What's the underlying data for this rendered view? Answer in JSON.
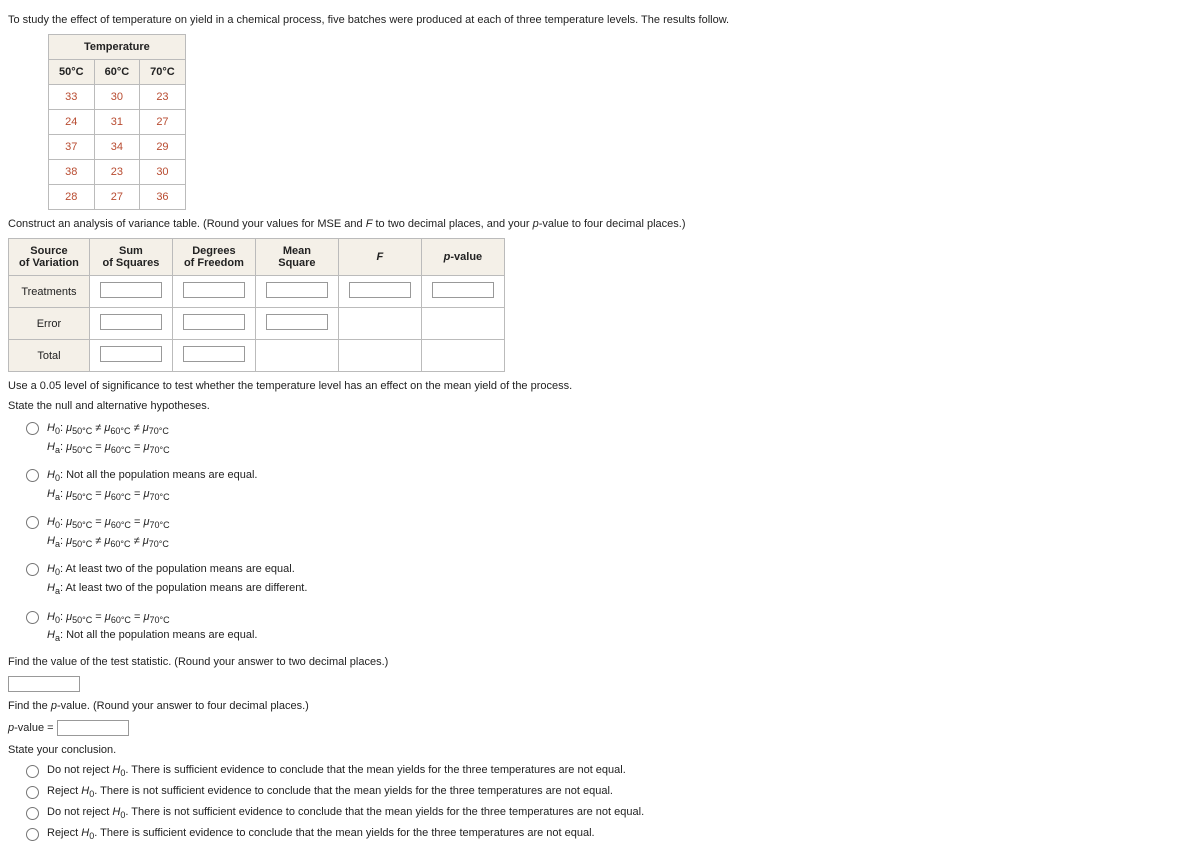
{
  "intro": "To study the effect of temperature on yield in a chemical process, five batches were produced at each of three temperature levels. The results follow.",
  "temp_table": {
    "header_span": "Temperature",
    "cols": [
      "50°C",
      "60°C",
      "70°C"
    ],
    "rows": [
      [
        "33",
        "30",
        "23"
      ],
      [
        "24",
        "31",
        "27"
      ],
      [
        "37",
        "34",
        "29"
      ],
      [
        "38",
        "23",
        "30"
      ],
      [
        "28",
        "27",
        "36"
      ]
    ]
  },
  "anova_instruction": "Construct an analysis of variance table. (Round your values for MSE and F to two decimal places, and your p-value to four decimal places.)",
  "anova_headers": {
    "source": "Source\nof Variation",
    "ss": "Sum\nof Squares",
    "df": "Degrees\nof Freedom",
    "ms": "Mean\nSquare",
    "f": "F",
    "p": "p-value"
  },
  "anova_rows": [
    "Treatments",
    "Error",
    "Total"
  ],
  "sig_instruction": "Use a 0.05 level of significance to test whether the temperature level has an effect on the mean yield of the process.",
  "state_hyp": "State the null and alternative hypotheses.",
  "mu50": "μ",
  "s50": "50°C",
  "mu60": "μ",
  "s60": "60°C",
  "mu70": "μ",
  "s70": "70°C",
  "hyps": {
    "opt1_h0": "H₀: μ50°C ≠ μ60°C ≠ μ70°C",
    "opt1_ha": "Hₐ: μ50°C = μ60°C = μ70°C",
    "opt2_h0": "H₀: Not all the population means are equal.",
    "opt2_ha": "Hₐ: μ50°C = μ60°C = μ70°C",
    "opt3_h0": "H₀: μ50°C = μ60°C = μ70°C",
    "opt3_ha": "Hₐ: μ50°C ≠ μ60°C ≠ μ70°C",
    "opt4_h0": "H₀: At least two of the population means are equal.",
    "opt4_ha": "Hₐ: At least two of the population means are different.",
    "opt5_h0": "H₀: μ50°C = μ60°C = μ70°C",
    "opt5_ha": "Hₐ: Not all the population means are equal."
  },
  "find_test_stat": "Find the value of the test statistic. (Round your answer to two decimal places.)",
  "find_p": "Find the p-value. (Round your answer to four decimal places.)",
  "p_label": "p-value =",
  "state_concl": "State your conclusion.",
  "concl": {
    "c1": "Do not reject H₀. There is sufficient evidence to conclude that the mean yields for the three temperatures are not equal.",
    "c2": "Reject H₀. There is not sufficient evidence to conclude that the mean yields for the three temperatures are not equal.",
    "c3": "Do not reject H₀. There is not sufficient evidence to conclude that the mean yields for the three temperatures are not equal.",
    "c4": "Reject H₀. There is sufficient evidence to conclude that the mean yields for the three temperatures are not equal."
  }
}
